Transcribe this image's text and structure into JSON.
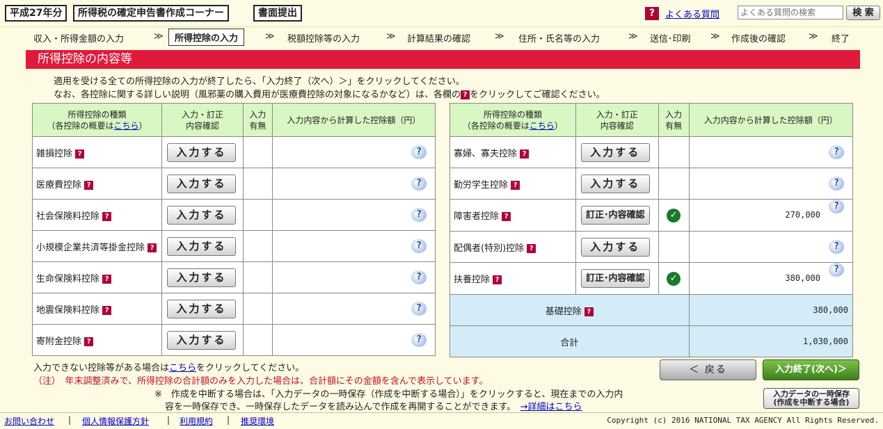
{
  "header": {
    "year": "平成27年分",
    "corner_title": "所得税の確定申告書作成コーナー",
    "mode": "書面提出",
    "faq_link": "よくある質問",
    "faq_placeholder": "よくある質問の検索",
    "search_label": "検 索",
    "help_icon": "question-icon"
  },
  "steps": [
    "収入・所得金額の入力",
    "所得控除の入力",
    "税額控除等の入力",
    "計算結果の確認",
    "住所・氏名等の入力",
    "送信･印刷",
    "作成後の確認",
    "終了"
  ],
  "step_separator": "≫",
  "current_step": 1,
  "section_title": "所得控除の内容等",
  "intro": {
    "line1": "適用を受ける全ての所得控除の入力が終了したら、「入力終了（次へ）＞」をクリックしてください。",
    "line2_a": "なお、各控除に関する詳しい説明（風邪薬の購入費用が医療費控除の対象になるかなど）は、各欄の",
    "line2_b": "をクリックしてご確認ください。"
  },
  "table_header": {
    "col1_line1": "所得控除の種類",
    "col1_line2_a": "（各控除の概要は",
    "col1_line2_link": "こちら",
    "col1_line2_b": "）",
    "col2_line1": "入力・訂正",
    "col2_line2": "内容確認",
    "col3_line1": "入力",
    "col3_line2": "有無",
    "col4": "入力内容から計算した控除額（円）"
  },
  "button_labels": {
    "input": "入力する",
    "correct": "訂正･内容確認"
  },
  "left_rows": [
    {
      "name": "雑損控除",
      "status": "input",
      "entered": false,
      "amount": ""
    },
    {
      "name": "医療費控除",
      "status": "input",
      "entered": false,
      "amount": ""
    },
    {
      "name": "社会保険料控除",
      "status": "input",
      "entered": false,
      "amount": ""
    },
    {
      "name": "小規模企業共済等掛金控除",
      "status": "input",
      "entered": false,
      "amount": ""
    },
    {
      "name": "生命保険料控除",
      "status": "input",
      "entered": false,
      "amount": ""
    },
    {
      "name": "地震保険料控除",
      "status": "input",
      "entered": false,
      "amount": ""
    },
    {
      "name": "寄附金控除",
      "status": "input",
      "entered": false,
      "amount": ""
    }
  ],
  "right_rows": [
    {
      "name": "寡婦、寡夫控除",
      "status": "input",
      "entered": false,
      "amount": ""
    },
    {
      "name": "勤労学生控除",
      "status": "input",
      "entered": false,
      "amount": ""
    },
    {
      "name": "障害者控除",
      "status": "correct",
      "entered": true,
      "amount": "270,000"
    },
    {
      "name": "配偶者(特別)控除",
      "status": "input",
      "entered": false,
      "amount": ""
    },
    {
      "name": "扶養控除",
      "status": "correct",
      "entered": true,
      "amount": "380,000"
    }
  ],
  "basic_deduction": {
    "label": "基礎控除",
    "amount": "380,000"
  },
  "total": {
    "label": "合計",
    "amount": "1,030,000"
  },
  "notes": {
    "unavailable_a": "入力できない控除等がある場合は",
    "unavailable_link": "こちら",
    "unavailable_b": "をクリックしてください。",
    "attention": "（注）　年末調整済みで、所得控除の合計額のみを入力した場合は、合計額にその金額を含んで表示しています。",
    "save_line1": "※　作成を中断する場合は、「入力データの一時保存（作成を中断する場合）」をクリックすると、現在までの入力内",
    "save_line2": "容を一時保存でき、一時保存したデータを読み込んで作成を再開することができます。",
    "detail_link": "→詳細はこちら"
  },
  "nav": {
    "back": "＜ 戻る",
    "next": "入力終了(次へ)＞",
    "save_line1": "入力データの一時保存",
    "save_line2": "(作成を中断する場合)"
  },
  "footer": {
    "links": [
      "お問い合わせ",
      "個人情報保護方針",
      "利用規約",
      "推奨環境"
    ],
    "copyright": "Copyright (c) 2016 NATIONAL TAX AGENCY All Rights Reserved."
  },
  "colors": {
    "title_bar": "#e01a3c",
    "header_green": "#d9f7c2",
    "sum_blue": "#d3ecf8",
    "next_green": "#3d7f1e"
  }
}
